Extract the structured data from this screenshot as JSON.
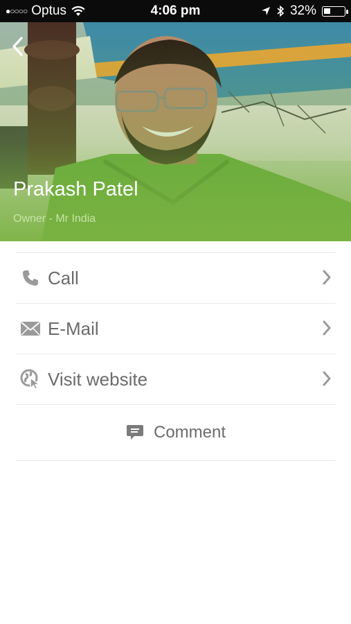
{
  "status_bar": {
    "carrier": "Optus",
    "time": "4:06 pm",
    "battery_percent": "32%",
    "battery_level": 0.32
  },
  "profile": {
    "name": "Prakash Patel",
    "subtitle": "Owner - Mr India",
    "header_color": "#7aa64a"
  },
  "actions": {
    "call_label": "Call",
    "email_label": "E-Mail",
    "website_label": "Visit website",
    "comment_label": "Comment"
  }
}
